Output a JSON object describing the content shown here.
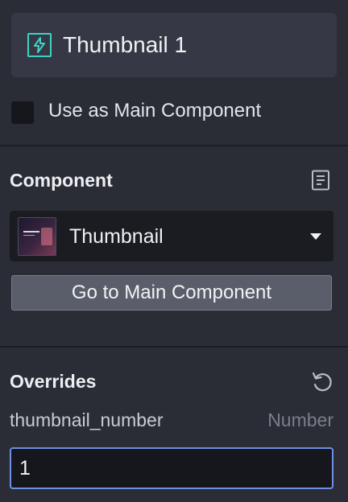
{
  "header": {
    "title": "Thumbnail 1",
    "icon": "lightning-bolt-icon",
    "icon_color": "#3ed2c5"
  },
  "main_component_toggle": {
    "label": "Use as Main Component",
    "checked": false
  },
  "component_section": {
    "title": "Component",
    "doc_icon": "document-icon",
    "selected_component": "Thumbnail",
    "goto_button_label": "Go to Main Component"
  },
  "overrides_section": {
    "title": "Overrides",
    "reset_icon": "reset-icon",
    "override": {
      "name": "thumbnail_number",
      "type": "Number",
      "value": "1"
    }
  }
}
